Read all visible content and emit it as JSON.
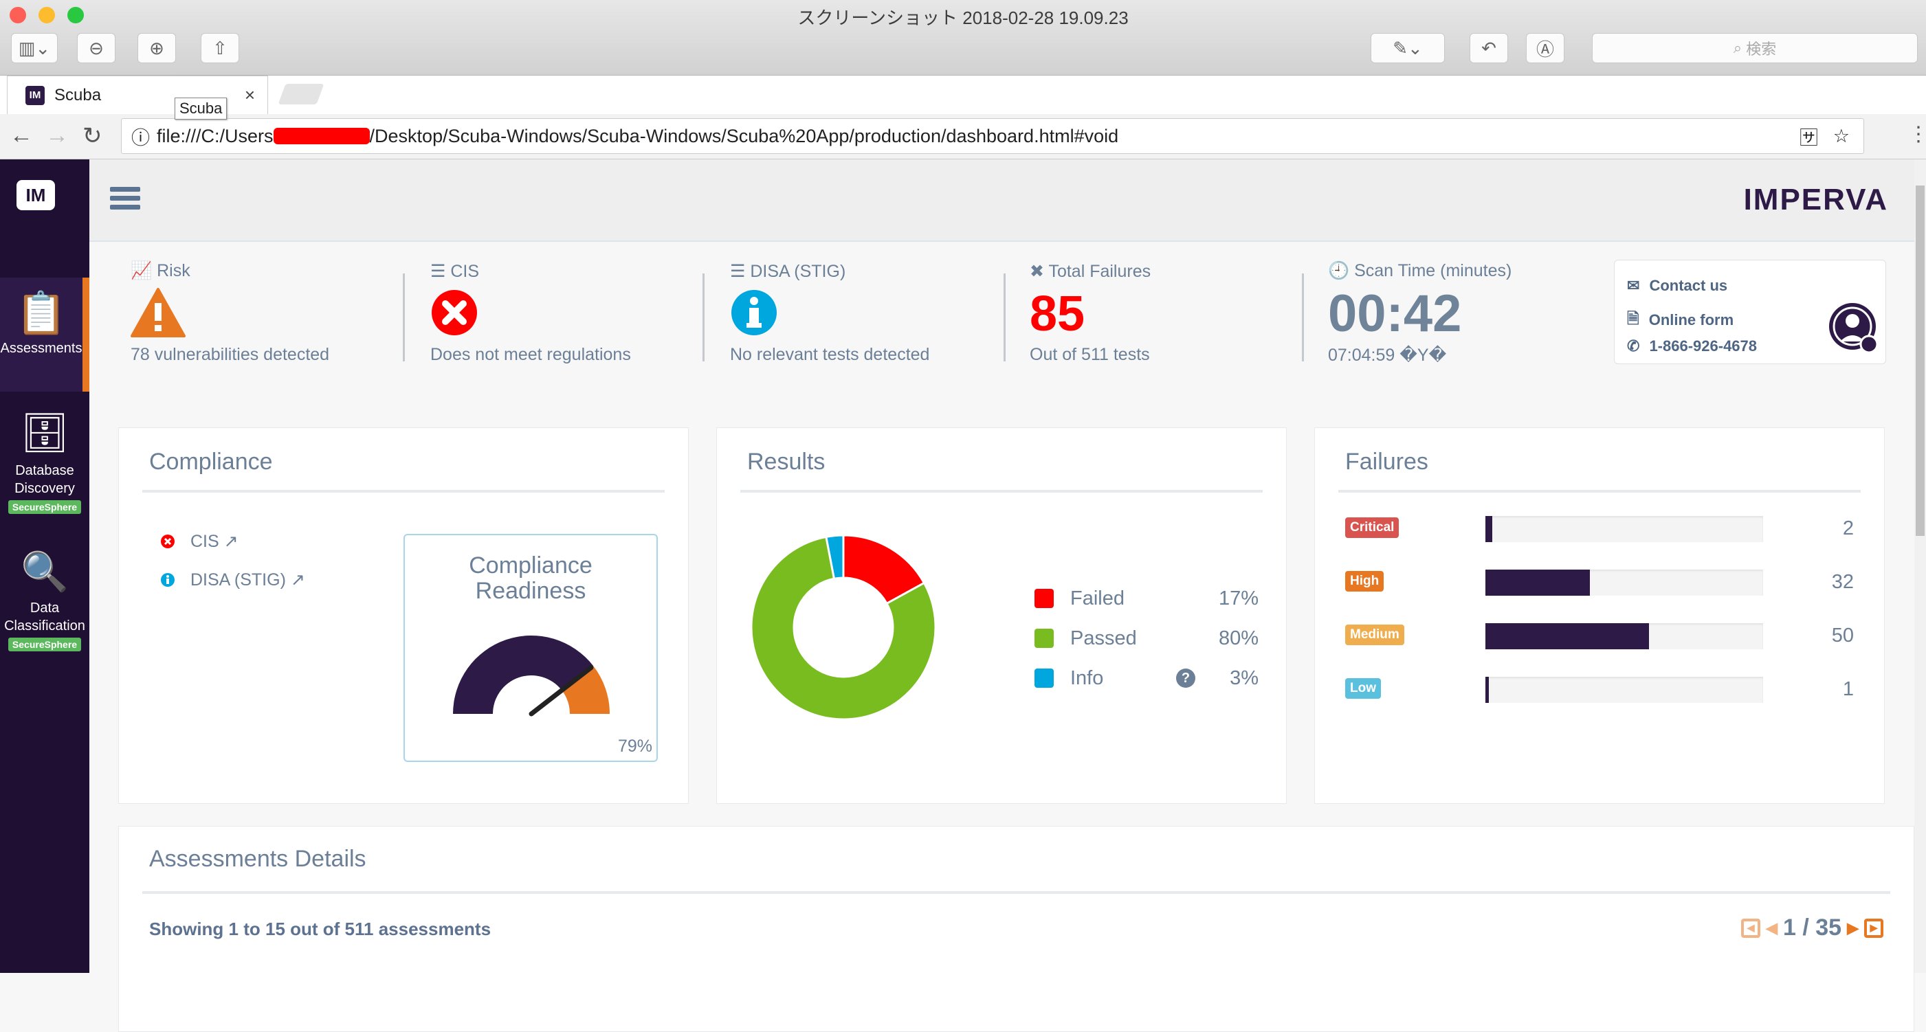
{
  "mac_window": {
    "title": "スクリーンショット 2018-02-28 19.09.23",
    "search_placeholder": "検索"
  },
  "browser": {
    "tab_title": "Scuba",
    "tab_tooltip": "Scuba",
    "tab_favicon": "IM",
    "url_prefix": "file:///C:/Users",
    "url_suffix": "/Desktop/Scuba-Windows/Scuba-Windows/Scuba%20App/production/dashboard.html#void"
  },
  "sidebar": {
    "logo": "IM",
    "items": [
      {
        "label": "Assessments",
        "icon": "clipboard-check-icon",
        "active": true
      },
      {
        "label": "Database Discovery",
        "icon": "database-icon",
        "badge": "SecureSphere"
      },
      {
        "label": "Data Classification",
        "icon": "document-search-icon",
        "badge": "SecureSphere"
      }
    ]
  },
  "header": {
    "brand": "IMPERVA"
  },
  "stats": {
    "risk": {
      "label": "Risk",
      "icon": "warning-triangle-icon",
      "sub": "78 vulnerabilities detected"
    },
    "cis": {
      "label": "CIS",
      "icon": "error-circle-icon",
      "sub": "Does not meet regulations"
    },
    "disa": {
      "label": "DISA (STIG)",
      "icon": "info-circle-icon",
      "sub": "No relevant tests detected"
    },
    "failures": {
      "label": "Total Failures",
      "value": "85",
      "sub": "Out of 511 tests"
    },
    "scan": {
      "label": "Scan Time (minutes)",
      "value": "00:42",
      "sub": "07:04:59 �Y�"
    }
  },
  "contact": {
    "contact_us": "Contact us",
    "online_form": "Online form",
    "phone": "1-866-926-4678"
  },
  "compliance": {
    "title": "Compliance",
    "items": [
      {
        "label": "CIS",
        "status": "fail"
      },
      {
        "label": "DISA (STIG)",
        "status": "info"
      }
    ],
    "gauge_title_1": "Compliance",
    "gauge_title_2": "Readiness",
    "gauge_value": 79,
    "gauge_label": "79%"
  },
  "results": {
    "title": "Results",
    "legend": [
      {
        "name": "Failed",
        "value": 17,
        "label": "17%",
        "color": "#ff0000"
      },
      {
        "name": "Passed",
        "value": 80,
        "label": "80%",
        "color": "#78bc20"
      },
      {
        "name": "Info",
        "value": 3,
        "label": "3%",
        "color": "#00a6de"
      }
    ]
  },
  "failures": {
    "title": "Failures",
    "max": 85,
    "rows": [
      {
        "label": "Critical",
        "count": 2,
        "count_label": "2",
        "color": "#d9534f"
      },
      {
        "label": "High",
        "count": 32,
        "count_label": "32",
        "color": "#e87722"
      },
      {
        "label": "Medium",
        "count": 50,
        "count_label": "50",
        "color": "#f0ad4e"
      },
      {
        "label": "Low",
        "count": 1,
        "count_label": "1",
        "color": "#5bc0de"
      }
    ]
  },
  "details": {
    "title": "Assessments Details",
    "showing": "Showing 1 to 15 out of 511 assessments",
    "page": "1 / 35"
  },
  "chart_data": [
    {
      "type": "pie",
      "title": "Results",
      "categories": [
        "Failed",
        "Passed",
        "Info"
      ],
      "values": [
        17,
        80,
        3
      ],
      "colors": [
        "#ff0000",
        "#78bc20",
        "#00a6de"
      ],
      "legend": "right"
    },
    {
      "type": "bar",
      "title": "Failures",
      "categories": [
        "Critical",
        "High",
        "Medium",
        "Low"
      ],
      "values": [
        2,
        32,
        50,
        1
      ],
      "xlim": [
        0,
        85
      ]
    }
  ]
}
